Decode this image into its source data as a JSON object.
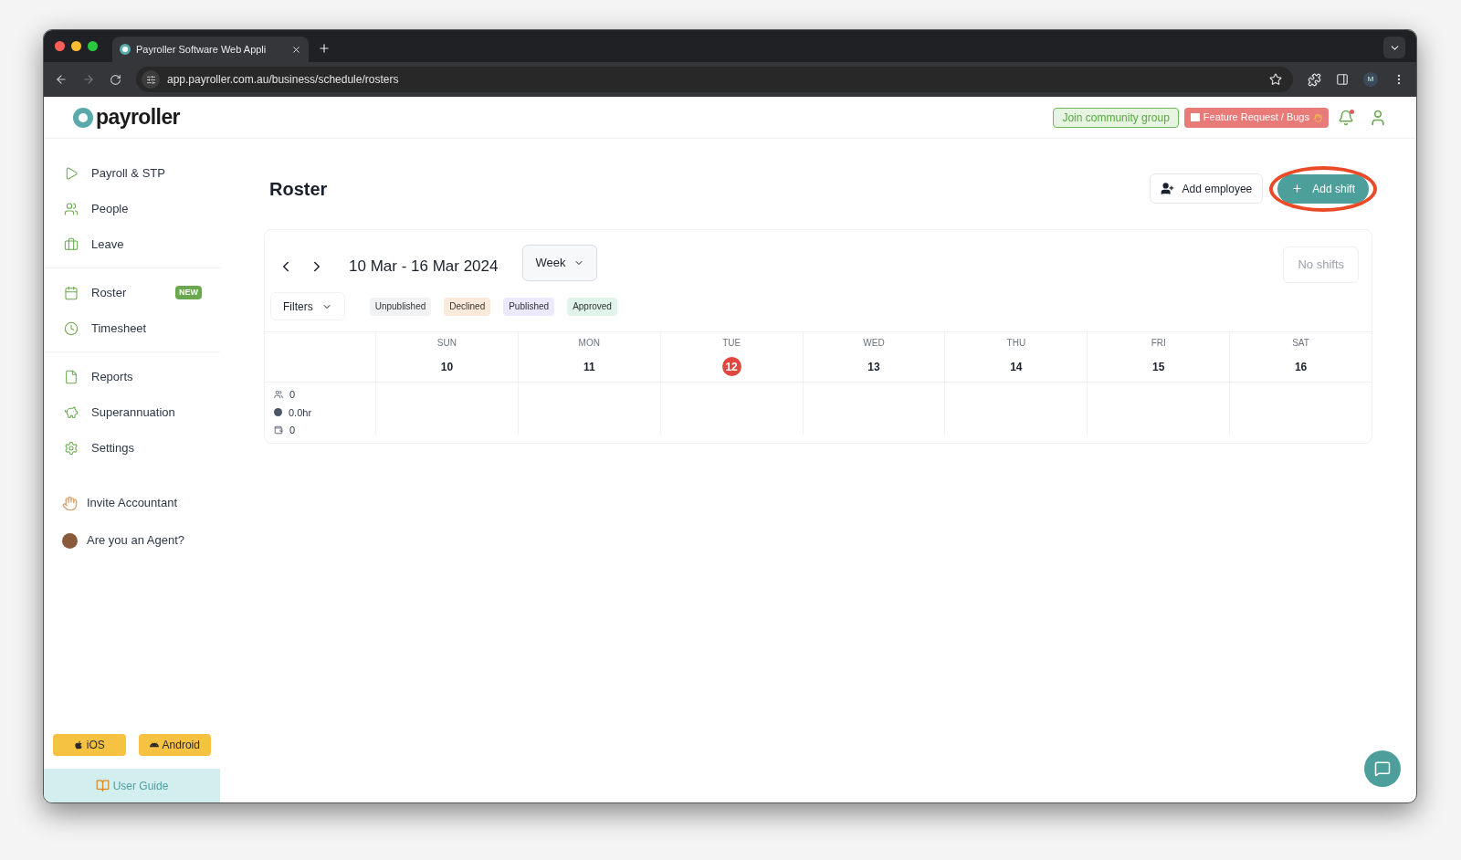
{
  "browser": {
    "tab_title": "Payroller Software Web Appli",
    "url": "app.payroller.com.au/business/schedule/rosters",
    "profile_initial": "M"
  },
  "header": {
    "logo": "payroller",
    "community_button": "Join community group",
    "feature_button": "Feature Request / Bugs",
    "notification_dot": true
  },
  "sidebar": {
    "groups": [
      [
        {
          "label": "Payroll & STP"
        },
        {
          "label": "People"
        },
        {
          "label": "Leave"
        }
      ],
      [
        {
          "label": "Roster",
          "badge": "NEW"
        },
        {
          "label": "Timesheet"
        }
      ],
      [
        {
          "label": "Reports"
        },
        {
          "label": "Superannuation"
        },
        {
          "label": "Settings"
        }
      ]
    ],
    "extras": [
      {
        "label": "Invite Accountant"
      },
      {
        "label": "Are you an Agent?"
      }
    ],
    "app_buttons": [
      {
        "label": "iOS"
      },
      {
        "label": "Android"
      }
    ],
    "user_guide": "User Guide"
  },
  "page": {
    "title": "Roster",
    "add_employee": "Add employee",
    "add_shift": "Add shift",
    "add_shift_circled": true
  },
  "roster": {
    "range": "10 Mar - 16 Mar 2024",
    "view": "Week",
    "no_shifts": {
      "label": "No shifts",
      "disabled": true
    },
    "filters": "Filters",
    "statuses": [
      {
        "label": "Unpublished",
        "color": "#f1f2f4"
      },
      {
        "label": "Declined",
        "color": "#fbe9d9"
      },
      {
        "label": "Published",
        "color": "#ece8fd"
      },
      {
        "label": "Approved",
        "color": "#e1f4ea"
      }
    ],
    "days": [
      {
        "name": "SUN",
        "date": "10",
        "today": false
      },
      {
        "name": "MON",
        "date": "11",
        "today": false
      },
      {
        "name": "TUE",
        "date": "12",
        "today": true
      },
      {
        "name": "WED",
        "date": "13",
        "today": false
      },
      {
        "name": "THU",
        "date": "14",
        "today": false
      },
      {
        "name": "FRI",
        "date": "15",
        "today": false
      },
      {
        "name": "SAT",
        "date": "16",
        "today": false
      }
    ],
    "summary": [
      {
        "kind": "people",
        "value": "0"
      },
      {
        "kind": "hours",
        "value": "0.0hr"
      },
      {
        "kind": "cost",
        "value": "0"
      }
    ]
  }
}
